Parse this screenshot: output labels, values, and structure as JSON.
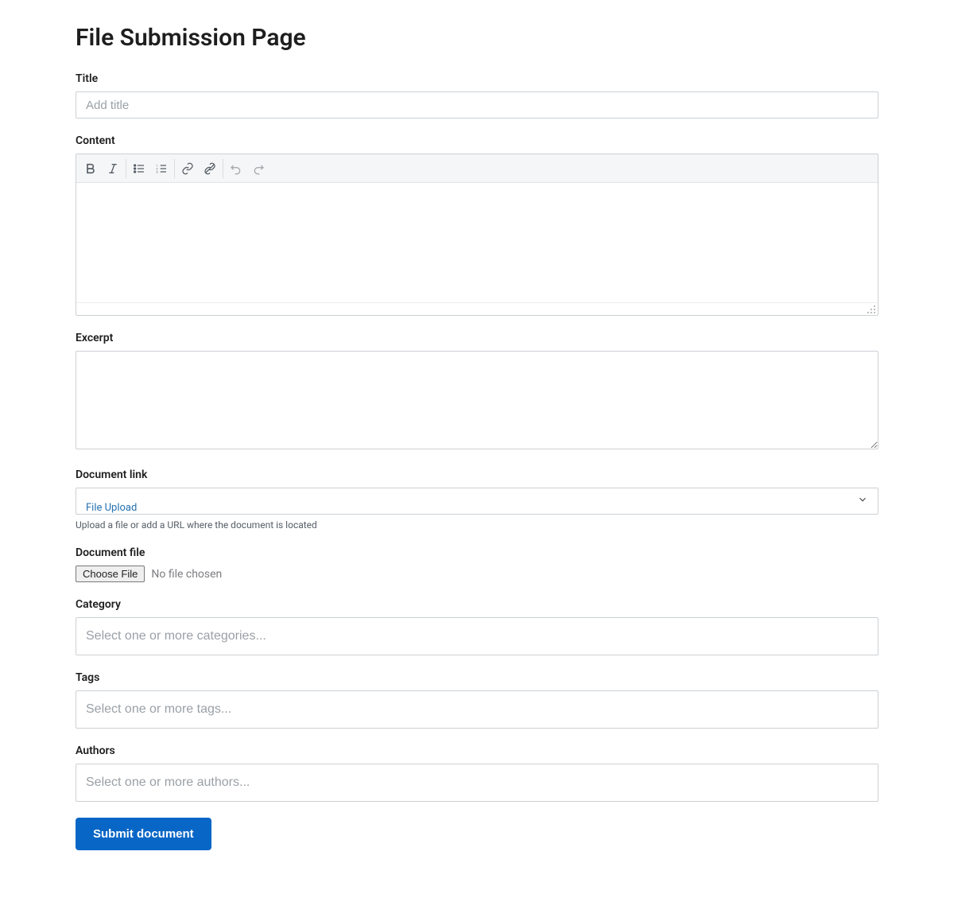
{
  "page": {
    "heading": "File Submission Page"
  },
  "labels": {
    "title": "Title",
    "content": "Content",
    "excerpt": "Excerpt",
    "document_link": "Document link",
    "document_file": "Document file",
    "category": "Category",
    "tags": "Tags",
    "authors": "Authors"
  },
  "placeholders": {
    "title": "Add title",
    "category": "Select one or more categories...",
    "tags": "Select one or more tags...",
    "authors": "Select one or more authors..."
  },
  "editor_toolbar": {
    "bold": "bold",
    "italic": "italic",
    "ul": "bulleted-list",
    "ol": "numbered-list",
    "link": "link",
    "unlink": "unlink",
    "undo": "undo",
    "redo": "redo"
  },
  "document_link": {
    "selected_option": "File Upload",
    "help": "Upload a file or add a URL where the document is located"
  },
  "document_file": {
    "button": "Choose File",
    "status": "No file chosen"
  },
  "submit": {
    "label": "Submit document"
  },
  "colors": {
    "primary": "#0866c6",
    "border": "#ccd0d4"
  }
}
